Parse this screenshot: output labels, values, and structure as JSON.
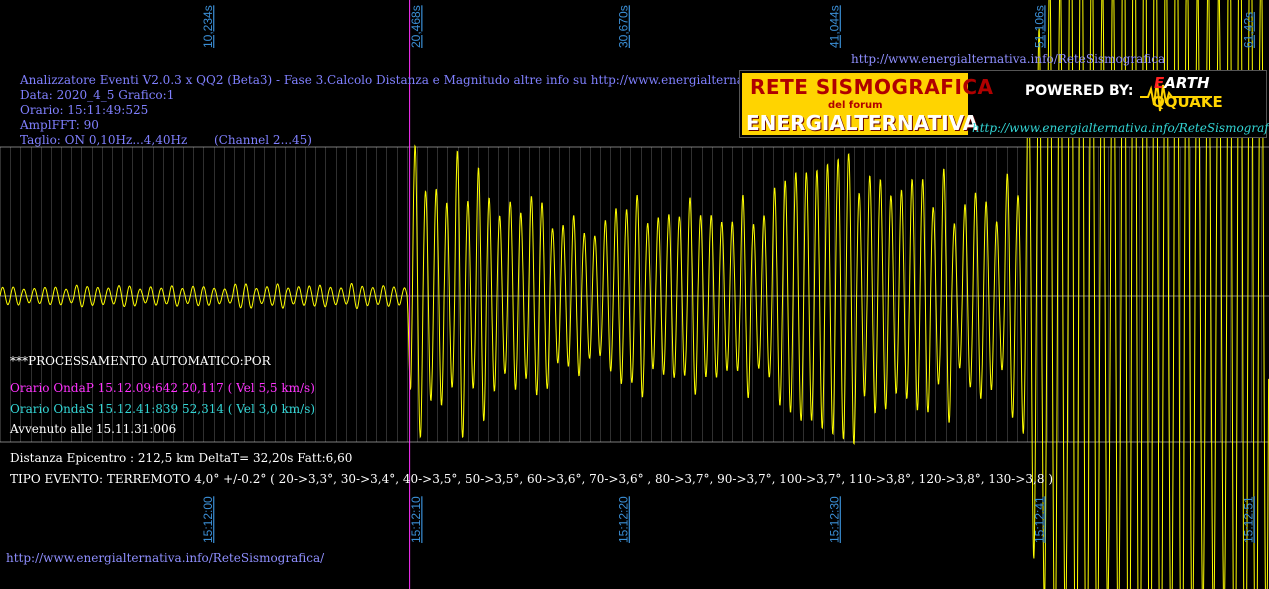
{
  "header": {
    "url_top": "http://www.energialternativa.info/ReteSismografica",
    "line1": "Analizzatore Eventi V2.0.3 x QQ2 (Beta3) - Fase 3.Calcolo Distanza e Magnitudo altre info su http://www.energialternativa.info/ReteSism",
    "line2": "Data: 2020_4_5 Grafico:1",
    "line3": "Orario: 15:11:49:525",
    "line4": "AmplFFT: 90",
    "line5": "Taglio: ON 0,10Hz...4,40Hz       (Channel 2...45)"
  },
  "logo": {
    "title1": "RETE SISMOGRAFICA",
    "subtitle": "del forum",
    "title2": "ENERGIALTERNATIVA",
    "powered": "POWERED BY:",
    "brand_e": "E",
    "brand_rest1": "ARTH",
    "brand_line2": "QQUAKE",
    "url": "http://www.energialternativa.info/ReteSismografica"
  },
  "analysis": {
    "processing": "***PROCESSAMENTO AUTOMATICO:POR",
    "p_wave": "Orario OndaP 15.12.09:642  20,117 ( Vel 5,5 km/s)",
    "s_wave": "Orario OndaS 15.12.41:839  52,314 ( Vel 3,0 km/s)",
    "occurred": "Avvenuto alle 15.11.31:006",
    "distance": "Distanza Epicentro : 212,5 km DeltaT= 32,20s  Fatt:6,60",
    "event_type": "TIPO EVENTO: TERREMOTO 4,0° +/-0.2° ( 20->3,3°, 30->3,4°, 40->3,5°, 50->3,5°, 60->3,6°, 70->3,6° , 80->3,7°, 90->3,7°, 100->3,7°, 110->3,8°, 120->3,8°, 130->3,8 )"
  },
  "footer": {
    "url": "http://www.energialternativa.info/ReteSismografica/"
  },
  "colors": {
    "background": "#000000",
    "trace": "#ffff00",
    "p_marker": "#ff33ff",
    "s_marker": "#ffff00",
    "grid": "#ffffff",
    "tick_text": "#3b8fd6",
    "info_text": "#8080ff"
  },
  "chart_data": {
    "type": "line",
    "xlabel": "",
    "ylabel": "",
    "x_unit": "seconds from window start",
    "top_ticks": [
      "10,234s",
      "20,468s",
      "30,670s",
      "41,044s",
      "51,106s",
      "61,4?s"
    ],
    "top_tick_values": [
      10.234,
      20.468,
      30.67,
      41.044,
      51.106,
      61.4
    ],
    "bottom_ticks": [
      "15:12:00",
      "15:12:10",
      "15:12:20",
      "15:12:30",
      "15:12:41",
      "15:12:51"
    ],
    "bottom_tick_values": [
      10.234,
      20.468,
      30.67,
      41.044,
      51.106,
      61.4
    ],
    "xlim": [
      0,
      62.4
    ],
    "ylim": [
      -1,
      1
    ],
    "markers": [
      {
        "label": "OndaP",
        "x": 20.117
      },
      {
        "label": "OndaS",
        "x": 52.314
      }
    ],
    "series": [
      {
        "amplitude_envelope": [
          [
            0,
            0.06
          ],
          [
            20.0,
            0.07
          ],
          [
            20.2,
            0.95
          ],
          [
            21.0,
            0.78
          ],
          [
            22.0,
            0.85
          ],
          [
            25.0,
            0.62
          ],
          [
            30.0,
            0.55
          ],
          [
            35.0,
            0.58
          ],
          [
            40.0,
            0.7
          ],
          [
            42.0,
            1.0
          ],
          [
            45.0,
            0.72
          ],
          [
            50.0,
            0.66
          ],
          [
            52.3,
            3.0
          ],
          [
            62.4,
            3.0
          ]
        ],
        "period_s": 0.52
      }
    ]
  }
}
